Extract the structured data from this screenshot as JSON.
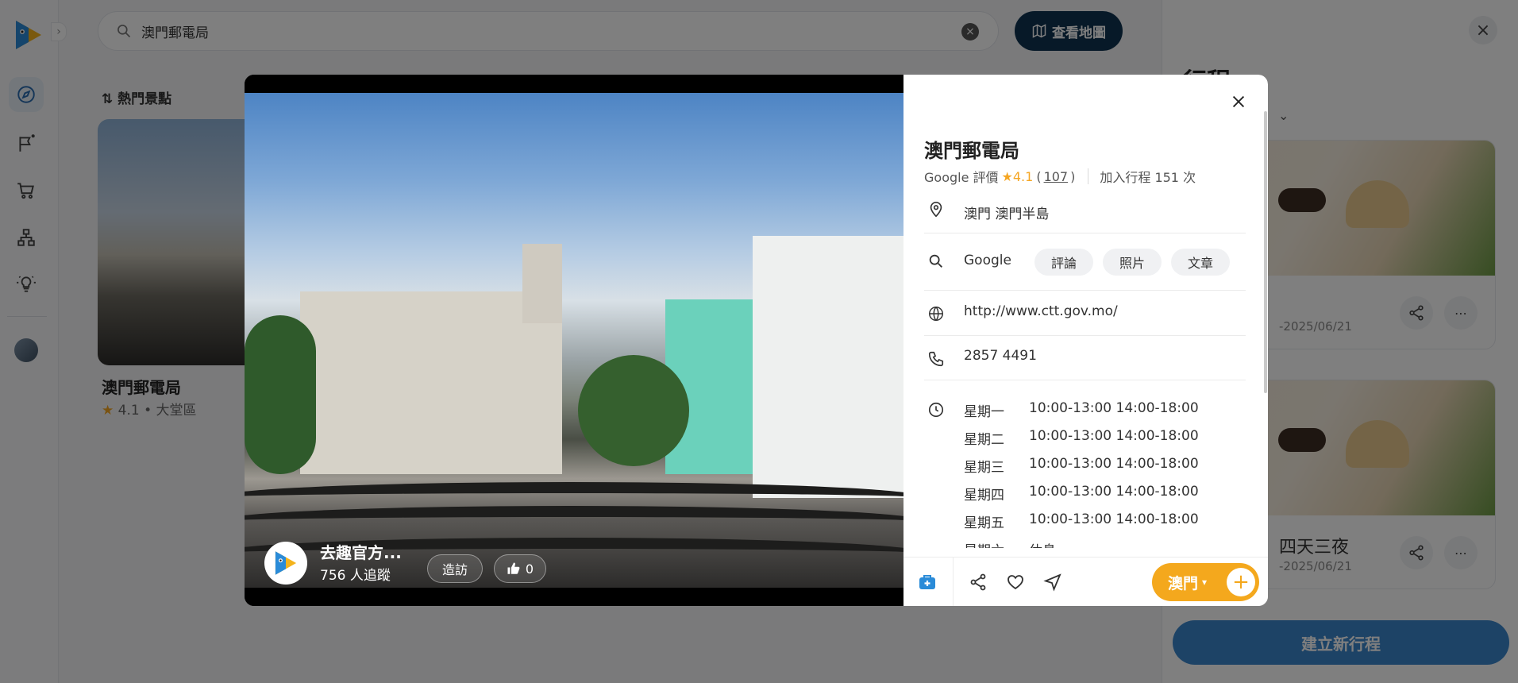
{
  "search": {
    "value": "澳門郵電局"
  },
  "header": {
    "map_button_label": "查看地圖"
  },
  "list": {
    "sort_label": "熱門景點",
    "card": {
      "name": "澳門郵電局",
      "rating": "4.1",
      "area": "大堂區",
      "meta_sep": "•"
    }
  },
  "right_panel": {
    "title": "行程",
    "trips": [
      {
        "name": "",
        "date": "-2025/06/21"
      },
      {
        "name": "四天三夜",
        "date": "-2025/06/21"
      }
    ],
    "new_trip_label": "建立新行程"
  },
  "modal": {
    "author": {
      "name": "去趣官方...",
      "followers": "756 人追蹤"
    },
    "visit_label": "造訪",
    "like_count": "0",
    "place": {
      "title": "澳門郵電局",
      "rating_source": "Google 評價",
      "rating": "4.1",
      "review_count": "107",
      "paren_open": "(",
      "paren_close": ")",
      "added_to_trips": "加入行程 151 次",
      "address": "澳門 澳門半島",
      "search_engine": "Google",
      "search_chips": [
        "評論",
        "照片",
        "文章"
      ],
      "website": "http://www.ctt.gov.mo/",
      "phone": "2857 4491",
      "hours": [
        {
          "day": "星期一",
          "time": "10:00-13:00 14:00-18:00"
        },
        {
          "day": "星期二",
          "time": "10:00-13:00 14:00-18:00"
        },
        {
          "day": "星期三",
          "time": "10:00-13:00 14:00-18:00"
        },
        {
          "day": "星期四",
          "time": "10:00-13:00 14:00-18:00"
        },
        {
          "day": "星期五",
          "time": "10:00-13:00 14:00-18:00"
        },
        {
          "day": "星期六",
          "time": "休息"
        }
      ]
    },
    "footer": {
      "city_label": "澳門",
      "plus_label": "+"
    }
  },
  "colors": {
    "accent_orange": "#f4a81d",
    "brand_blue": "#3a86cc",
    "dark_navy": "#0f3350",
    "star": "#f5a623"
  },
  "icons": [
    "logo-icon",
    "compass-icon",
    "flag-icon",
    "cart-icon",
    "org-chart-icon",
    "lightbulb-icon",
    "search-icon",
    "clear-icon",
    "map-icon",
    "sort-icon",
    "close-icon",
    "location-icon",
    "globe-icon",
    "phone-icon",
    "clock-icon",
    "share-icon",
    "heart-icon",
    "navigate-icon",
    "thumbs-up-icon",
    "more-icon",
    "medical-bag-icon"
  ]
}
